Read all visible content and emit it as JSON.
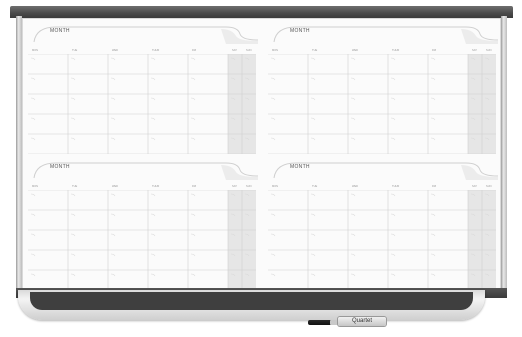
{
  "board": {
    "brand": "Quartet",
    "panels": [
      {
        "month": "MONTH",
        "days": [
          "MON",
          "TUE",
          "WED",
          "THUR",
          "FRI",
          "SAT",
          "SUN"
        ]
      },
      {
        "month": "MONTH",
        "days": [
          "MON",
          "TUE",
          "WED",
          "THUR",
          "FRI",
          "SAT",
          "SUN"
        ]
      },
      {
        "month": "MONTH",
        "days": [
          "MON",
          "TUE",
          "WED",
          "THUR",
          "FRI",
          "SAT",
          "SUN"
        ]
      },
      {
        "month": "MONTH",
        "days": [
          "MON",
          "TUE",
          "WED",
          "THUR",
          "FRI",
          "SAT",
          "SUN"
        ]
      }
    ],
    "weeks_per_month": 5,
    "colors": {
      "frame": "#4a4a4a",
      "weekend": "#e6e6e6",
      "grid": "#cfcfcf",
      "surface": "#fbfbfb"
    }
  }
}
